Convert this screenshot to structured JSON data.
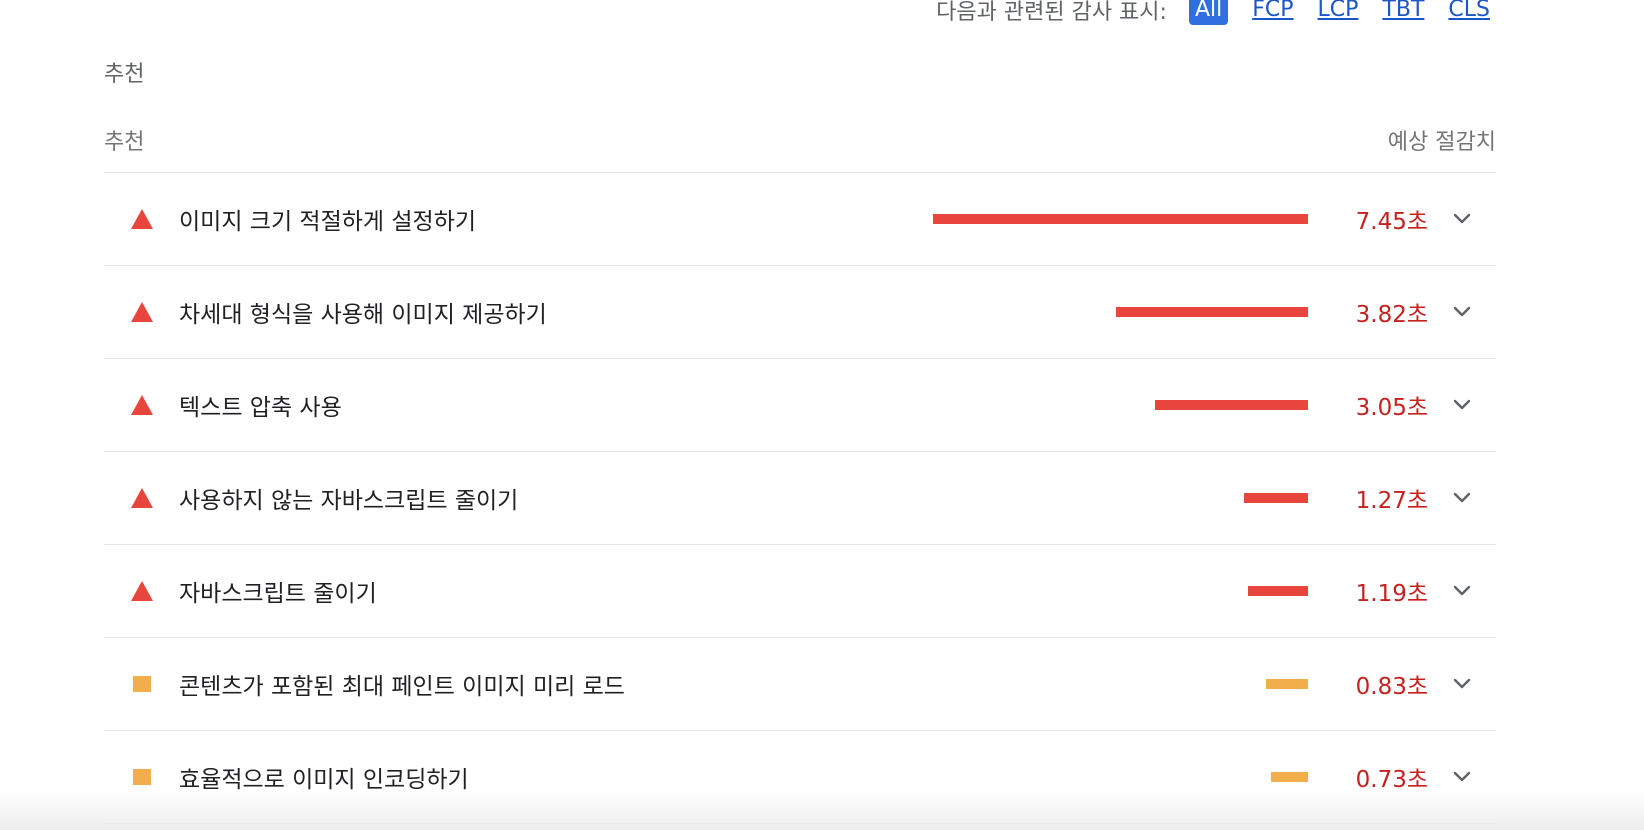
{
  "filter": {
    "lead": "다음과 관련된 감사 표시:",
    "chips": [
      {
        "label": "All",
        "active": true
      },
      {
        "label": "FCP",
        "active": false
      },
      {
        "label": "LCP",
        "active": false
      },
      {
        "label": "TBT",
        "active": false
      },
      {
        "label": "CLS",
        "active": false
      }
    ]
  },
  "section": {
    "title": "추천"
  },
  "table": {
    "col_left": "추천",
    "col_right": "예상 절감치",
    "rows": [
      {
        "title": "이미지 크기 적절하게 설정하기",
        "savings": "7.45초",
        "severity": "fail",
        "fraction": 1.0
      },
      {
        "title": "차세대 형식을 사용해 이미지 제공하기",
        "savings": "3.82초",
        "severity": "fail",
        "fraction": 0.513
      },
      {
        "title": "텍스트 압축 사용",
        "savings": "3.05초",
        "severity": "fail",
        "fraction": 0.409
      },
      {
        "title": "사용하지 않는 자바스크립트 줄이기",
        "savings": "1.27초",
        "severity": "fail",
        "fraction": 0.17
      },
      {
        "title": "자바스크립트 줄이기",
        "savings": "1.19초",
        "severity": "fail",
        "fraction": 0.16
      },
      {
        "title": "콘텐츠가 포함된 최대 페인트 이미지 미리 로드",
        "savings": "0.83초",
        "severity": "average",
        "fraction": 0.111
      },
      {
        "title": "효율적으로 이미지 인코딩하기",
        "savings": "0.73초",
        "severity": "average",
        "fraction": 0.098
      }
    ]
  },
  "colors": {
    "fail": "#e8453c",
    "average": "#f2ae4a",
    "savings_text": "#c5221f",
    "chip_active_bg": "#2f6fe0",
    "link": "#1a56c9"
  },
  "icons": {
    "fail": "red-triangle-icon",
    "average": "orange-square-icon",
    "expand": "chevron-down-icon"
  }
}
